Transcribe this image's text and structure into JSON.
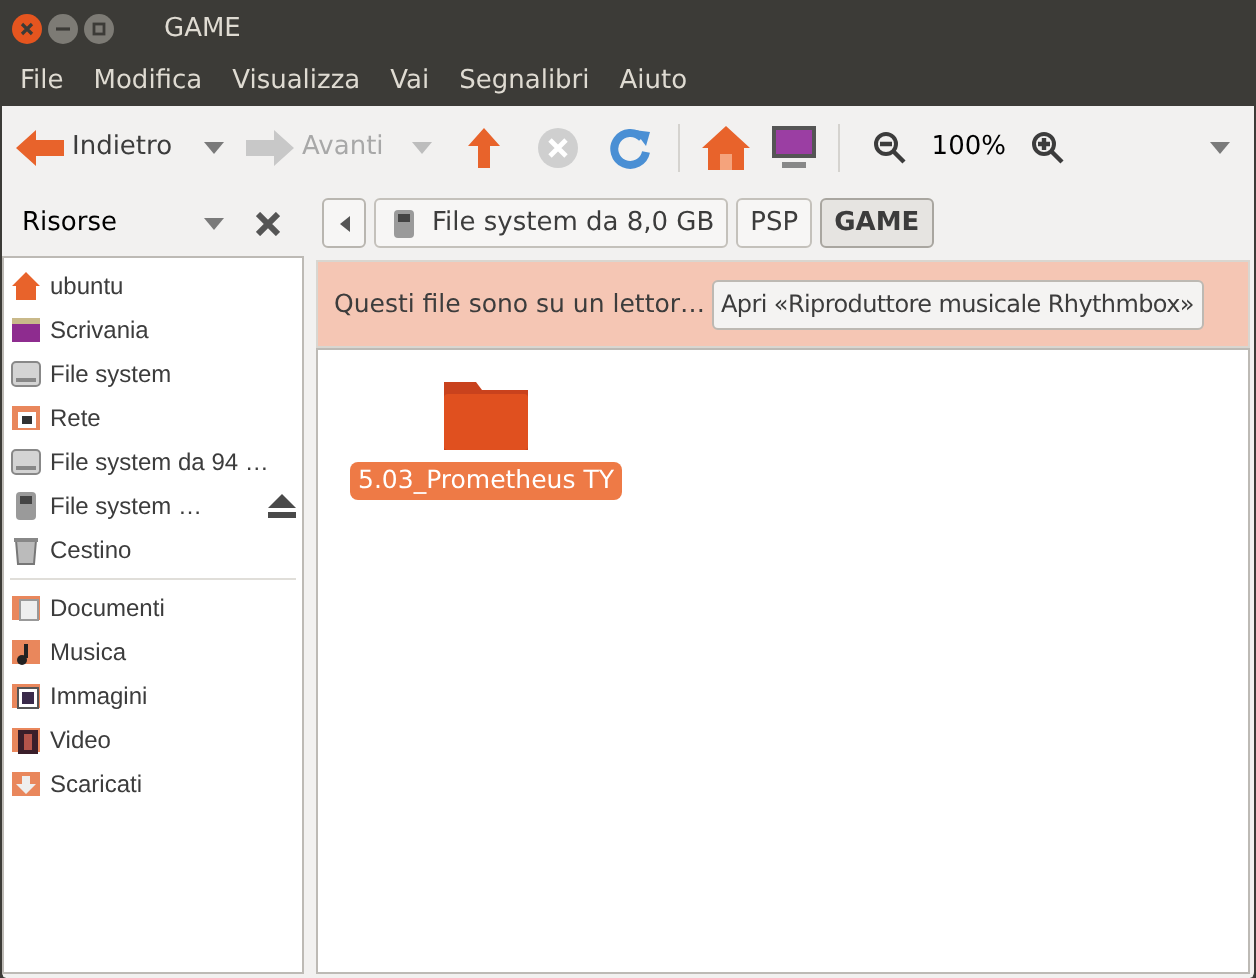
{
  "window": {
    "title": "GAME"
  },
  "menu": [
    "File",
    "Modifica",
    "Visualizza",
    "Vai",
    "Segnalibri",
    "Aiuto"
  ],
  "toolbar": {
    "back": {
      "label": "Indietro",
      "disabled": false
    },
    "forward": {
      "label": "Avanti",
      "disabled": true
    },
    "zoom": "100%"
  },
  "sidebar": {
    "title": "Risorse",
    "places": [
      {
        "label": "ubuntu",
        "kind": "home",
        "ejectable": false
      },
      {
        "label": "Scrivania",
        "kind": "desktop",
        "ejectable": false
      },
      {
        "label": "File system",
        "kind": "drive",
        "ejectable": false
      },
      {
        "label": "Rete",
        "kind": "network",
        "ejectable": false
      },
      {
        "label": "File system da 94 …",
        "kind": "drive",
        "ejectable": false
      },
      {
        "label": "File system …",
        "kind": "player",
        "ejectable": true
      },
      {
        "label": "Cestino",
        "kind": "trash",
        "ejectable": false
      }
    ],
    "bookmarks": [
      {
        "label": "Documenti",
        "kind": "documents"
      },
      {
        "label": "Musica",
        "kind": "music"
      },
      {
        "label": "Immagini",
        "kind": "pictures"
      },
      {
        "label": "Video",
        "kind": "video"
      },
      {
        "label": "Scaricati",
        "kind": "downloads"
      }
    ]
  },
  "path": [
    {
      "label": "File system da 8,0 GB",
      "kind": "device",
      "selected": false
    },
    {
      "label": "PSP",
      "kind": "folder",
      "selected": false
    },
    {
      "label": "GAME",
      "kind": "folder",
      "selected": true
    }
  ],
  "info_bar": {
    "message": "Questi file sono su un lettor…",
    "button": "Apri «Riproduttore musicale Rhythmbox»"
  },
  "files": [
    {
      "name": "5.03_Prometheus TY",
      "selected": true
    }
  ]
}
